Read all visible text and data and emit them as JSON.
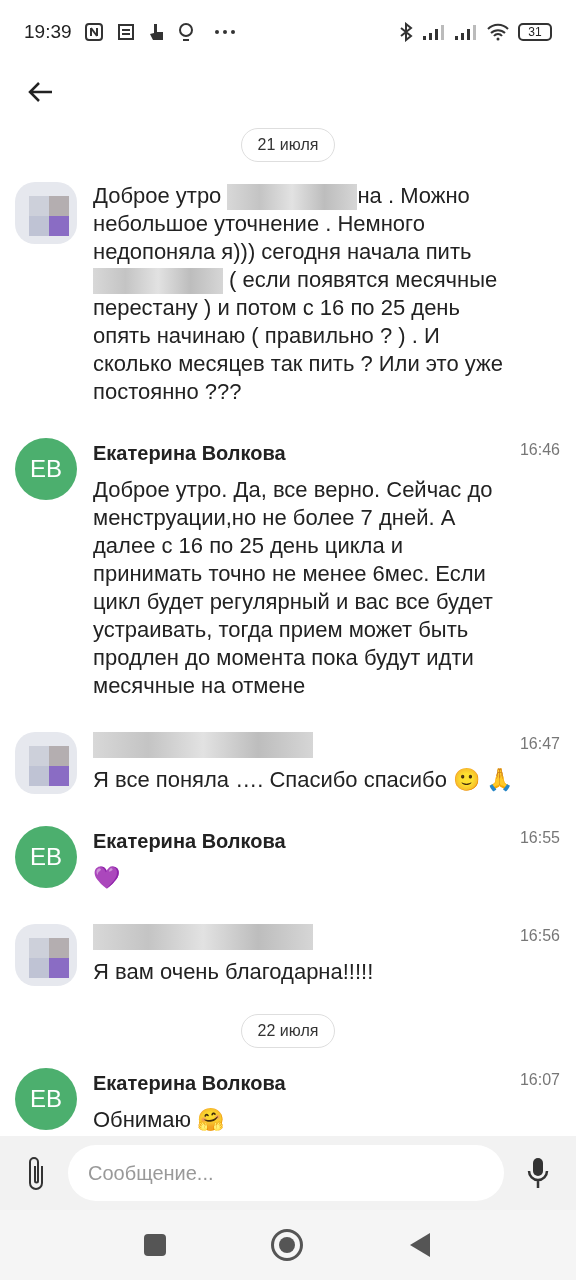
{
  "status_bar": {
    "time": "19:39",
    "battery": "31"
  },
  "messages": [
    {
      "avatar": {
        "kind": "redacted"
      },
      "sender": {
        "kind": "none"
      },
      "date_chip": "21 июля",
      "segments": [
        {
          "kind": "text",
          "text": "Доброе утро "
        },
        {
          "kind": "redacted"
        },
        {
          "kind": "text",
          "text": "на . Можно небольшое уточнение . Немного недопоняла я))) сегодня начала пить "
        },
        {
          "kind": "redacted"
        },
        {
          "kind": "text",
          "text": " ( если появятся месячные перестану ) и потом с 16 по 25 день опять начинаю ( правильно ? ) . И сколько месяцев так пить ? Или это уже постоянно ???"
        }
      ]
    },
    {
      "avatar": {
        "kind": "initials",
        "text": "ЕВ",
        "color": "#4caf6e"
      },
      "sender": {
        "kind": "name",
        "text": "Екатерина Волкова"
      },
      "time": "16:46",
      "segments": [
        {
          "kind": "text",
          "text": "Доброе утро. Да, все верно. Сейчас до менструации,но не более 7 дней. А далее с 16 по 25 день цикла и принимать точно не менее 6мес. Если цикл будет регулярный и вас все будет устраивать, тогда прием может быть продлен до момента пока будут идти месячные на отмене"
        }
      ]
    },
    {
      "avatar": {
        "kind": "redacted"
      },
      "sender": {
        "kind": "redacted"
      },
      "time": "16:47",
      "segments": [
        {
          "kind": "text",
          "text": "Я все поняла …. Спасибо спасибо 🙂 🙏"
        }
      ]
    },
    {
      "avatar": {
        "kind": "initials",
        "text": "ЕВ",
        "color": "#4caf6e"
      },
      "sender": {
        "kind": "name",
        "text": "Екатерина Волкова"
      },
      "time": "16:55",
      "segments": [
        {
          "kind": "text",
          "text": "💜"
        }
      ]
    },
    {
      "avatar": {
        "kind": "redacted"
      },
      "sender": {
        "kind": "redacted"
      },
      "time": "16:56",
      "segments": [
        {
          "kind": "text",
          "text": "Я вам очень благодарна!!!!!"
        }
      ]
    },
    {
      "avatar": {
        "kind": "initials",
        "text": "ЕВ",
        "color": "#4caf6e"
      },
      "sender": {
        "kind": "name",
        "text": "Екатерина Волкова"
      },
      "time": "16:07",
      "date_chip": "22 июля",
      "segments": [
        {
          "kind": "text",
          "text": "Обнимаю 🤗"
        }
      ]
    }
  ],
  "composer": {
    "placeholder": "Сообщение..."
  }
}
